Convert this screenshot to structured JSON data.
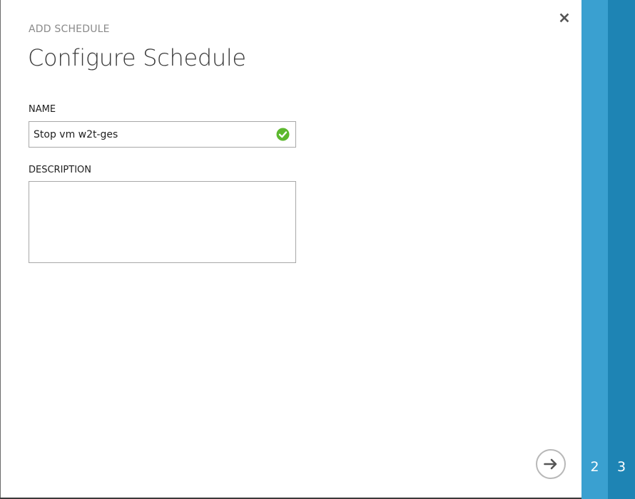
{
  "dialog": {
    "subtitle": "ADD SCHEDULE",
    "title": "Configure Schedule"
  },
  "form": {
    "name_label": "NAME",
    "name_value": "Stop vm w2t-ges",
    "name_valid": true,
    "description_label": "DESCRIPTION",
    "description_value": ""
  },
  "wizard": {
    "steps": [
      {
        "number": "2"
      },
      {
        "number": "3"
      }
    ],
    "next_icon": "arrow-right-circle-icon",
    "close_icon": "close-icon"
  },
  "colors": {
    "step_2": "#3aa0d0",
    "step_3": "#1e84b4",
    "valid_check": "#5cb82e"
  }
}
